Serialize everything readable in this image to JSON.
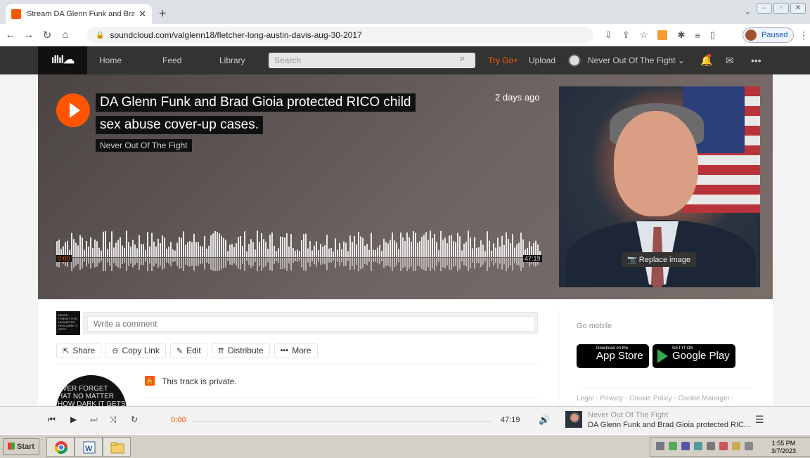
{
  "browser": {
    "tab_title": "Stream DA Glenn Funk and Brad Gi...",
    "tab_close": "✕",
    "new_tab": "+",
    "url": "soundcloud.com/valglenn18/fletcher-long-austin-davis-aug-30-2017",
    "profile_status": "Paused"
  },
  "header": {
    "logo": "ıllıl☁",
    "nav": [
      "Home",
      "Feed",
      "Library"
    ],
    "search_placeholder": "Search",
    "try_go": "Try Go+",
    "upload": "Upload",
    "username": "Never Out Of The Fight ⌄",
    "more": "•••"
  },
  "track": {
    "title_line1": "DA Glenn Funk and Brad Gioia protected RICO child",
    "title_line2": "sex abuse cover-up cases.",
    "artist": "Never Out Of The Fight",
    "posted": "2 days ago",
    "time_start": "0:00",
    "time_end": "47:19",
    "replace_image": "Replace image"
  },
  "comments": {
    "placeholder": "Write a comment",
    "avatar_text": "NEVER FORGET THAT NO MATTER HOW DARK IT GETS"
  },
  "actions": [
    {
      "icon": "share-icon",
      "label": "Share"
    },
    {
      "icon": "link-icon",
      "label": "Copy Link"
    },
    {
      "icon": "pencil-icon",
      "label": "Edit"
    },
    {
      "icon": "distribute-icon",
      "label": "Distribute"
    },
    {
      "icon": "more-icon",
      "label": "More"
    }
  ],
  "private_notice": "This track is private.",
  "artist_avatar_text": "EVER FORGET\nHAT NO MATTER\nHOW DARK IT GETS",
  "sidebar": {
    "go_mobile": "Go mobile",
    "app_store_small": "Download on the",
    "app_store_big": "App Store",
    "google_small": "GET IT ON",
    "google_big": "Google Play",
    "legal": "Legal - Privacy - Cookie Policy - Cookie Manager -"
  },
  "player": {
    "time_current": "0:00",
    "time_total": "47:19",
    "artist": "Never Out Of The Fight",
    "title": "DA Glenn Funk and Brad Gioia protected RIC..."
  },
  "taskbar": {
    "start": "Start",
    "clock_time": "1:55 PM",
    "clock_date": "3/7/2023"
  }
}
